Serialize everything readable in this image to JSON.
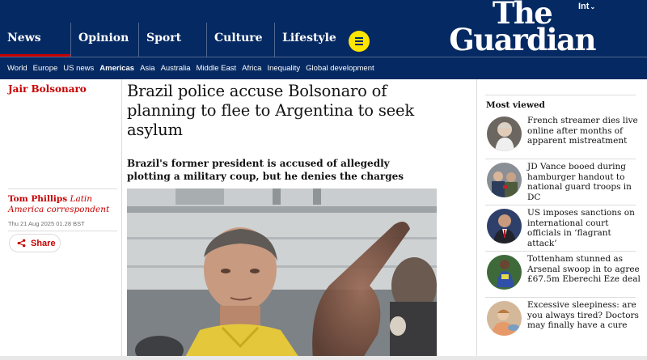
{
  "header": {
    "edition": "Int",
    "logo_line1": "The",
    "logo_line2": "Guardian",
    "pillars": [
      {
        "label": "News"
      },
      {
        "label": "Opinion"
      },
      {
        "label": "Sport"
      },
      {
        "label": "Culture"
      },
      {
        "label": "Lifestyle"
      }
    ],
    "subnav": [
      "World",
      "Europe",
      "US news",
      "Americas",
      "Asia",
      "Australia",
      "Middle East",
      "Africa",
      "Inequality",
      "Global development"
    ],
    "colors": {
      "brand_blue": "#052962",
      "accent_red": "#c70000",
      "menu_yellow": "#ffe500"
    }
  },
  "article": {
    "series": "Jair Bolsonaro",
    "headline": "Brazil police accuse Bolsonaro of planning to flee to Argentina to seek asylum",
    "standfirst": "Brazil's former president is accused of allegedly plotting a military coup, but he denies the charges",
    "byline_name": "Tom Phillips",
    "byline_role": "Latin America correspondent",
    "dateline": "Thu 21 Aug 2025 01.28 BST",
    "share_label": "Share",
    "hero_image": "photo of Jair Bolsonaro in a yellow shirt pointing"
  },
  "most_viewed": {
    "title": "Most viewed",
    "items": [
      {
        "text": "French streamer dies live online after months of apparent mistreatment"
      },
      {
        "text": "JD Vance booed during hamburger handout to national guard troops in DC"
      },
      {
        "text": "US imposes sanctions on international court officials in ‘flagrant attack’"
      },
      {
        "text": "Tottenham stunned as Arsenal swoop in to agree £67.5m Eberechi Eze deal"
      },
      {
        "text": "Excessive sleepiness: are you always tired? Doctors may finally have a cure"
      }
    ]
  }
}
